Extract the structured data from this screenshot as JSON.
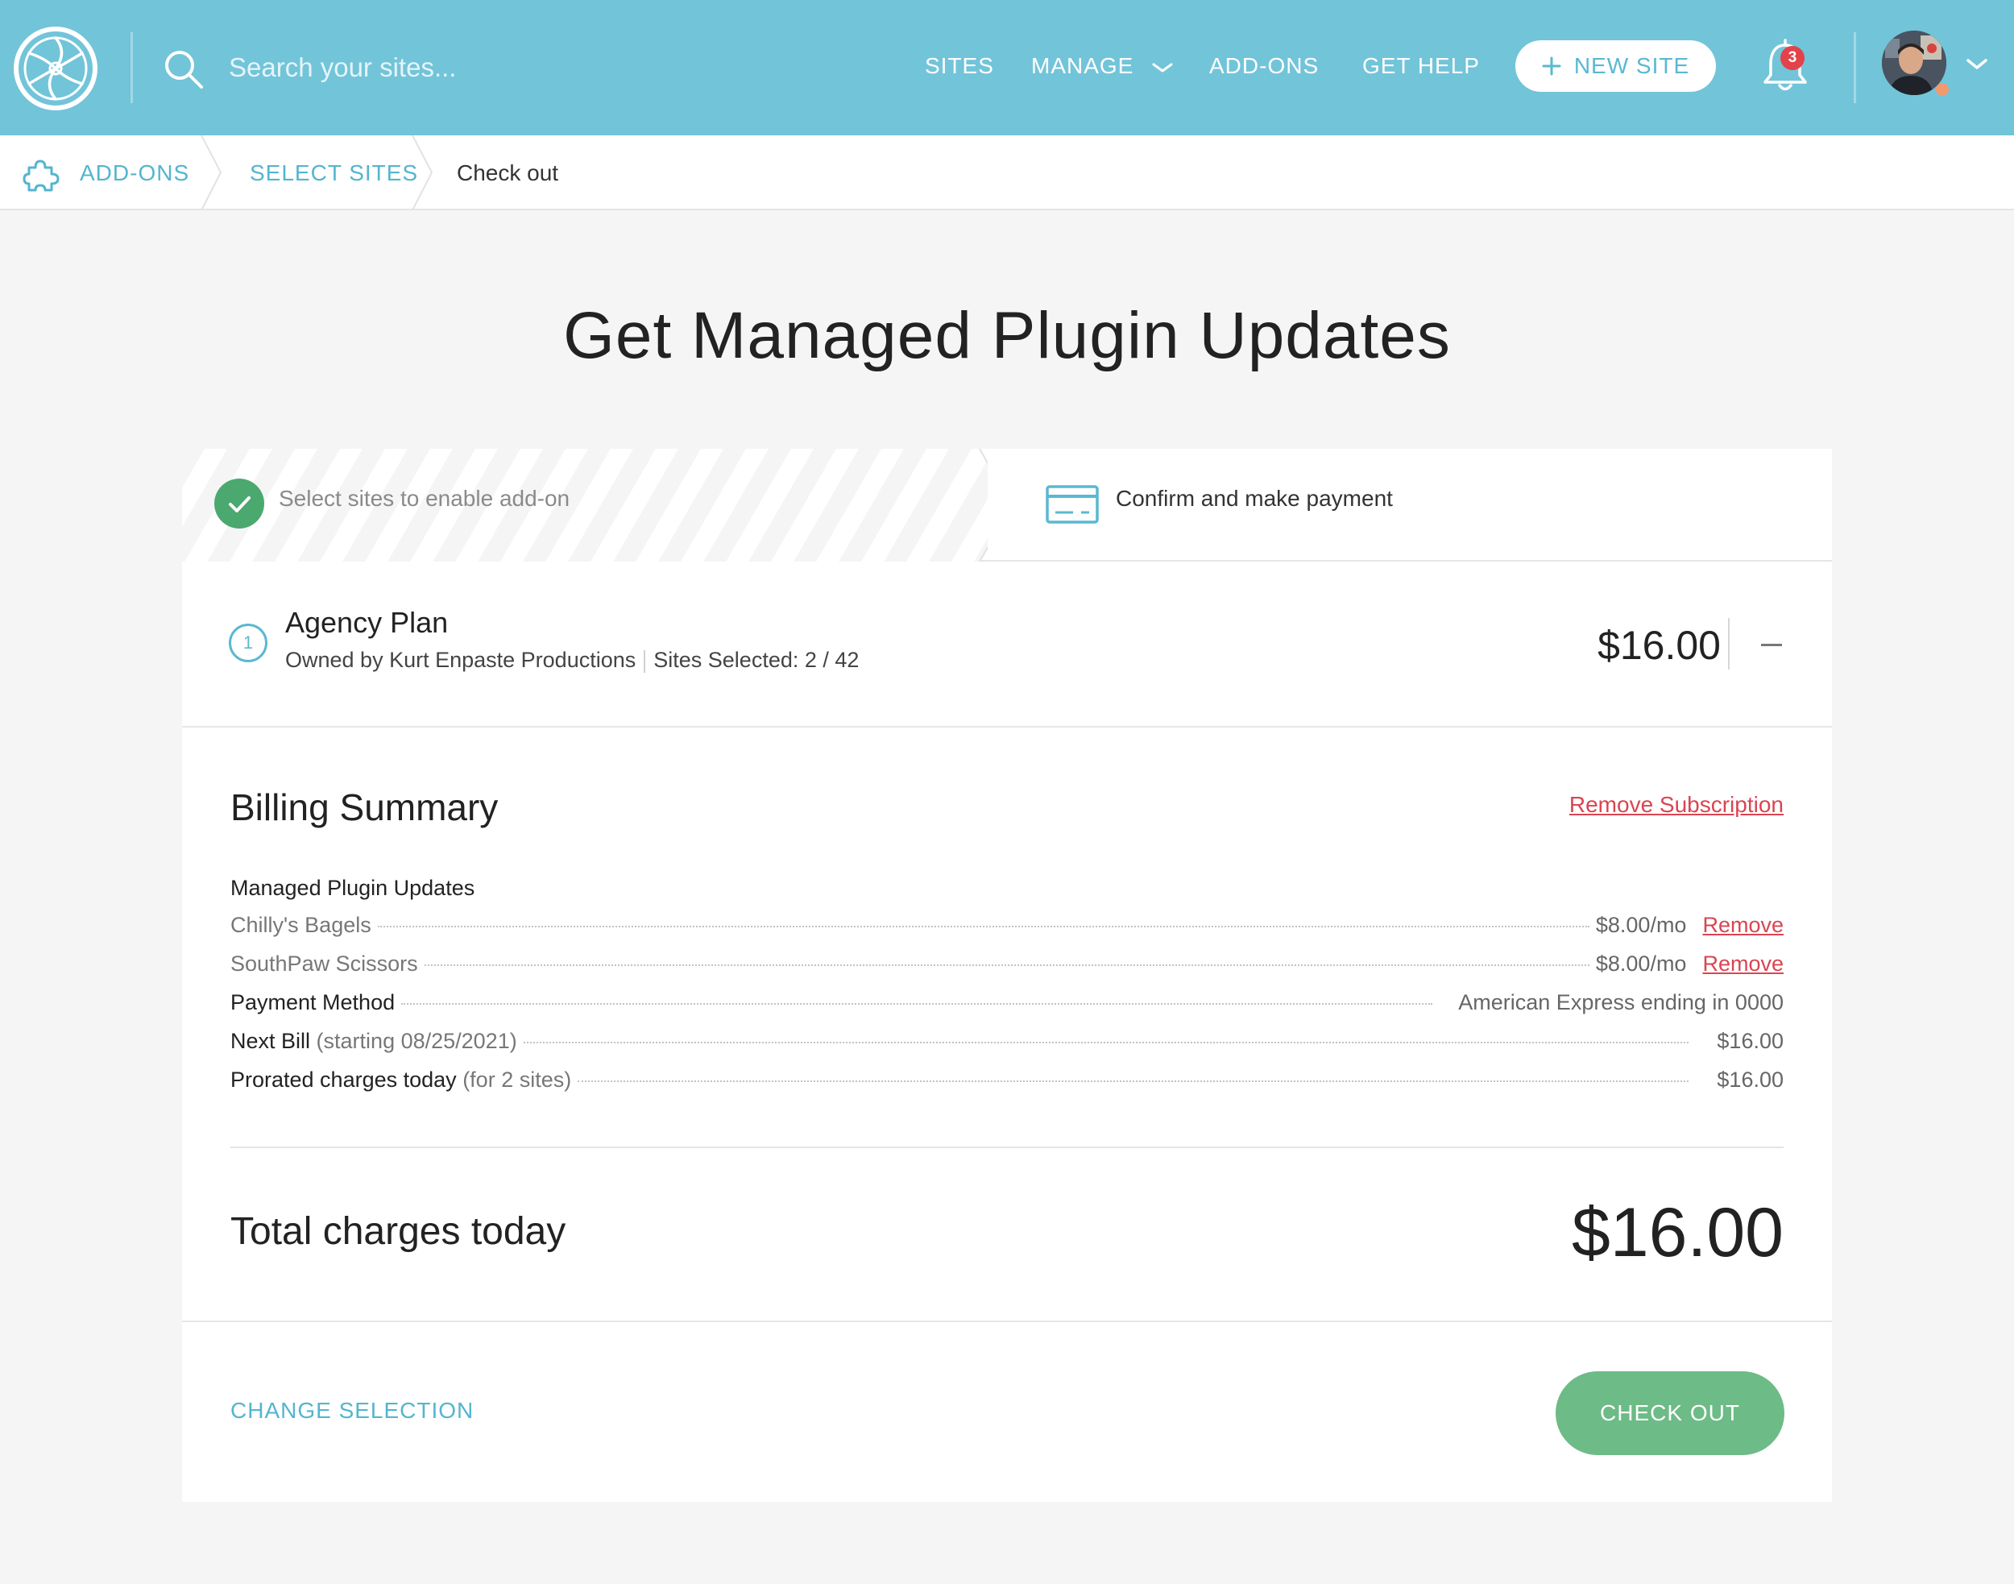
{
  "colors": {
    "topbar": "#72c4d9",
    "accent": "#54b5cf",
    "success": "#4ba86e",
    "checkout": "#6dbb86",
    "danger": "#d94552",
    "notification": "#e2424a"
  },
  "header": {
    "logo_icon": "aperture-logo-icon",
    "search": {
      "placeholder": "Search your sites..."
    },
    "nav": {
      "sites": "SITES",
      "manage": "MANAGE",
      "addons": "ADD-ONS",
      "help": "GET HELP"
    },
    "new_site": "NEW SITE",
    "notifications": {
      "count": "3"
    }
  },
  "breadcrumb": {
    "addons": "ADD-ONS",
    "select_sites": "SELECT SITES",
    "checkout": "Check out"
  },
  "page": {
    "title": "Get Managed Plugin Updates"
  },
  "steps": {
    "step1": "Select sites to enable add-on",
    "step2": "Confirm and make payment"
  },
  "plan": {
    "number": "1",
    "name": "Agency Plan",
    "owner": "Owned by Kurt Enpaste Productions",
    "sites_selected": "Sites Selected: 2 / 42",
    "price": "$16.00"
  },
  "billing": {
    "title": "Billing Summary",
    "remove_subscription": "Remove Subscription",
    "section": "Managed Plugin Updates",
    "sites": [
      {
        "name": "Chilly's Bagels",
        "price": "$8.00/mo",
        "remove": "Remove"
      },
      {
        "name": "SouthPaw Scissors",
        "price": "$8.00/mo",
        "remove": "Remove"
      }
    ],
    "payment_method": {
      "label": "Payment Method",
      "value": "American Express ending in 0000"
    },
    "next_bill": {
      "label": "Next Bill",
      "note": "(starting 08/25/2021)",
      "value": "$16.00"
    },
    "prorated": {
      "label": "Prorated charges today",
      "note": "(for 2 sites)",
      "value": "$16.00"
    },
    "total_label": "Total charges today",
    "total_value": "$16.00"
  },
  "footer": {
    "change_selection": "CHANGE SELECTION",
    "checkout": "CHECK OUT"
  }
}
